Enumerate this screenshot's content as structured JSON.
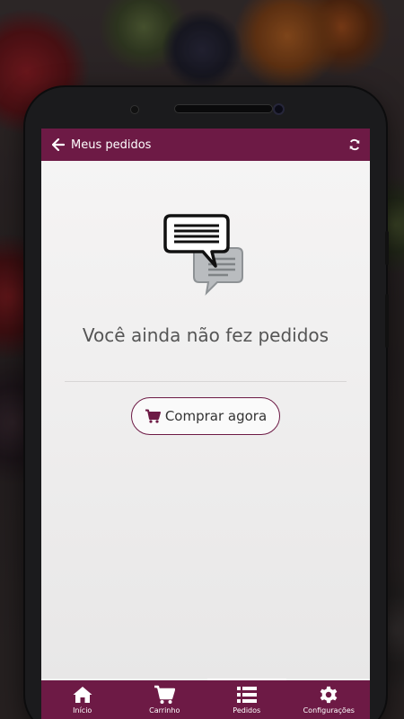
{
  "appbar": {
    "title": "Meus pedidos",
    "back_icon": "arrow-left-icon",
    "refresh_icon": "refresh-icon"
  },
  "empty_state": {
    "icon": "chat-bubbles-icon",
    "message": "Você ainda não fez pedidos",
    "button_label": "Comprar agora",
    "button_icon": "shopping-cart-icon"
  },
  "bottom_nav": {
    "items": [
      {
        "label": "Início",
        "icon": "home-icon"
      },
      {
        "label": "Carrinho",
        "icon": "shopping-cart-icon"
      },
      {
        "label": "Pedidos",
        "icon": "list-icon",
        "active": true
      },
      {
        "label": "Configurações",
        "icon": "gear-icon"
      }
    ]
  },
  "colors": {
    "primary": "#6d1a45",
    "background": "#f1f0f0",
    "text": "#555555"
  }
}
